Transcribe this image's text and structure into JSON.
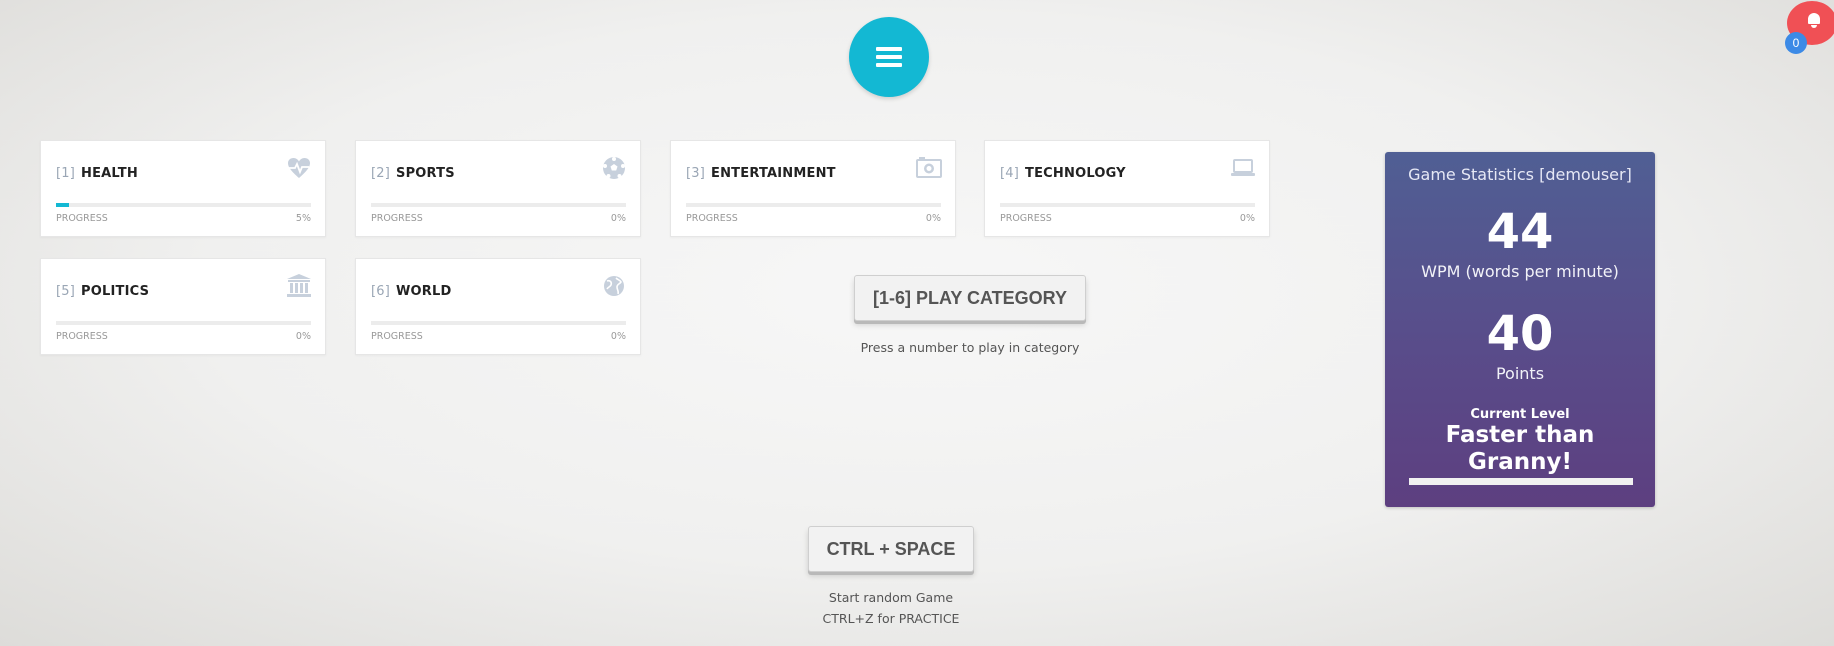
{
  "menu": {
    "icon": "hamburger-icon"
  },
  "notifications": {
    "icon": "bell-icon",
    "count": "0",
    "color": "#f05055",
    "badge_color": "#3c8ae6"
  },
  "accent_color": "#13b8d3",
  "categories": [
    {
      "num": "[1]",
      "name": "HEALTH",
      "icon": "heartbeat-icon",
      "progress_label": "PROGRESS",
      "progress_text": "5%",
      "progress": 0.05
    },
    {
      "num": "[2]",
      "name": "SPORTS",
      "icon": "soccer-ball-icon",
      "progress_label": "PROGRESS",
      "progress_text": "0%",
      "progress": 0
    },
    {
      "num": "[3]",
      "name": "ENTERTAINMENT",
      "icon": "camera-icon",
      "progress_label": "PROGRESS",
      "progress_text": "0%",
      "progress": 0
    },
    {
      "num": "[4]",
      "name": "TECHNOLOGY",
      "icon": "laptop-icon",
      "progress_label": "PROGRESS",
      "progress_text": "0%",
      "progress": 0
    },
    {
      "num": "[5]",
      "name": "POLITICS",
      "icon": "institution-icon",
      "progress_label": "PROGRESS",
      "progress_text": "0%",
      "progress": 0
    },
    {
      "num": "[6]",
      "name": "WORLD",
      "icon": "globe-icon",
      "progress_label": "PROGRESS",
      "progress_text": "0%",
      "progress": 0
    }
  ],
  "play_category": {
    "label": "[1-6] PLAY CATEGORY",
    "hint": "Press a number to play in category"
  },
  "random_game": {
    "label": "CTRL + SPACE",
    "hint1": "Start random Game",
    "hint2": "CTRL+Z for PRACTICE"
  },
  "stats": {
    "title": "Game Statistics [demouser]",
    "wpm": "44",
    "wpm_label": "WPM (words per minute)",
    "points": "40",
    "points_label": "Points",
    "level_label": "Current Level",
    "level_name": "Faster than Granny!",
    "level_progress": 1.0
  }
}
